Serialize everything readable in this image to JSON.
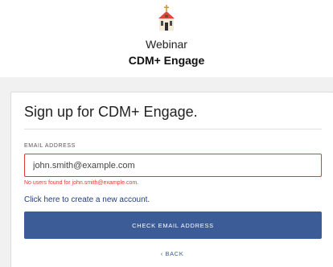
{
  "header": {
    "logo_icon": "building-icon",
    "event_label": "Webinar",
    "app_name": "CDM+ Engage"
  },
  "signup": {
    "title": "Sign up for CDM+ Engage.",
    "email_label": "EMAIL ADDRESS",
    "email_value": "john.smith@example.com",
    "error_message": "No users found for john.smith@example.com.",
    "create_account_link": "Click here to create a new account.",
    "check_button": "CHECK EMAIL ADDRESS",
    "back_link": "‹ BACK"
  },
  "colors": {
    "primary": "#3c5c97",
    "error": "#e53935",
    "link": "#22417e",
    "backdrop": "#f1f1f1"
  }
}
